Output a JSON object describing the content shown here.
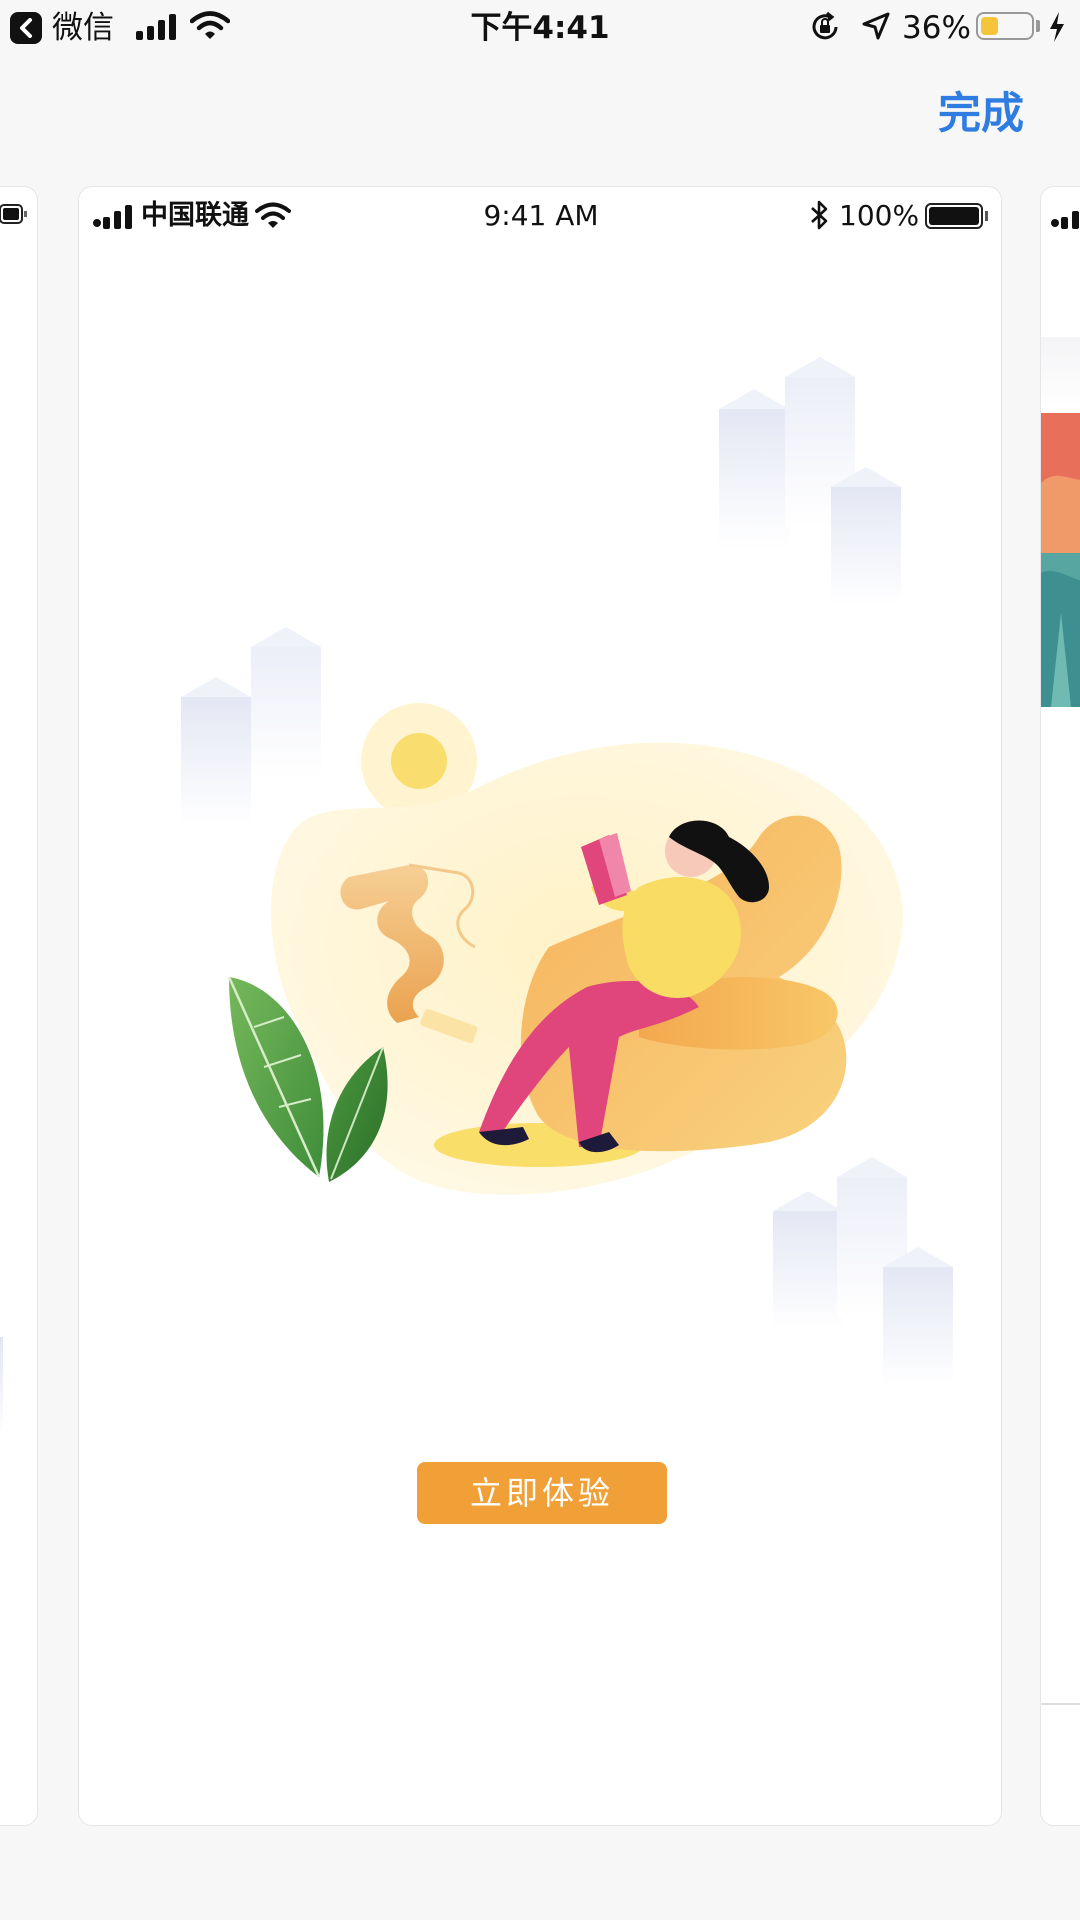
{
  "system_status": {
    "app_name": "微信",
    "time": "下午4:41",
    "battery_percent": "36%",
    "battery_level": 0.36,
    "icons": [
      "back-icon",
      "signal-icon",
      "wifi-icon",
      "rotation-lock-icon",
      "location-icon",
      "battery-icon",
      "charging-bolt-icon"
    ]
  },
  "nav": {
    "done_label": "完成"
  },
  "preview": {
    "status": {
      "carrier": "中国联通",
      "time": "9:41 AM",
      "battery_percent": "100%",
      "battery_level": 1.0
    },
    "cta_label": "立即体验",
    "colors": {
      "accent": "#f0a036",
      "done_blue": "#2f7de1"
    }
  }
}
